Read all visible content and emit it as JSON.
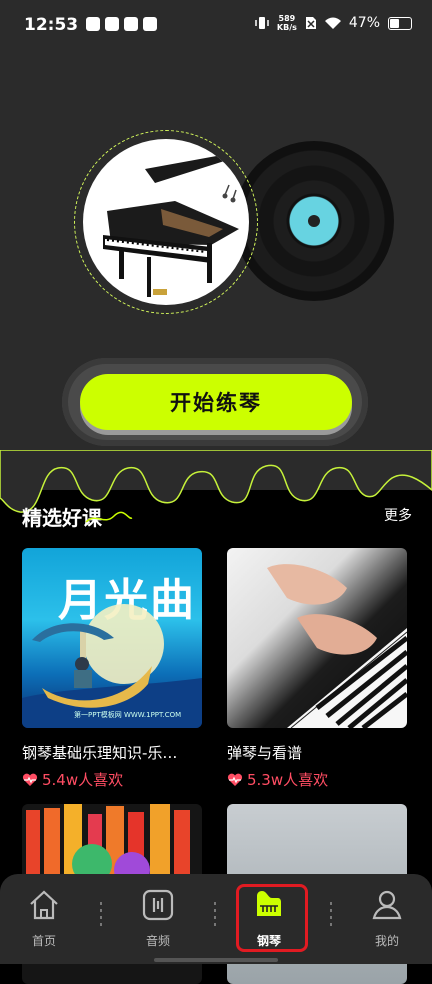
{
  "status_bar": {
    "time": "12:53",
    "net_speed_value": "589",
    "net_speed_unit": "KB/s",
    "battery": "47%"
  },
  "hero": {
    "start_button_label": "开始练琴",
    "accent_color": "#ccff00"
  },
  "section": {
    "title": "精选好课",
    "more_label": "更多"
  },
  "cards": [
    {
      "title": "钢琴基础乐理知识-乐…",
      "likes": "5.4w人喜欢",
      "image_text": "月光曲",
      "watermark": "第一PPT模板网 WWW.1PPT.COM"
    },
    {
      "title": "弹琴与看谱",
      "likes": "5.3w人喜欢"
    }
  ],
  "nav": {
    "items": [
      {
        "label": "首页",
        "icon": "home-icon"
      },
      {
        "label": "音频",
        "icon": "audio-icon"
      },
      {
        "label": "钢琴",
        "icon": "piano-icon",
        "active": true
      },
      {
        "label": "我的",
        "icon": "profile-icon"
      }
    ]
  }
}
